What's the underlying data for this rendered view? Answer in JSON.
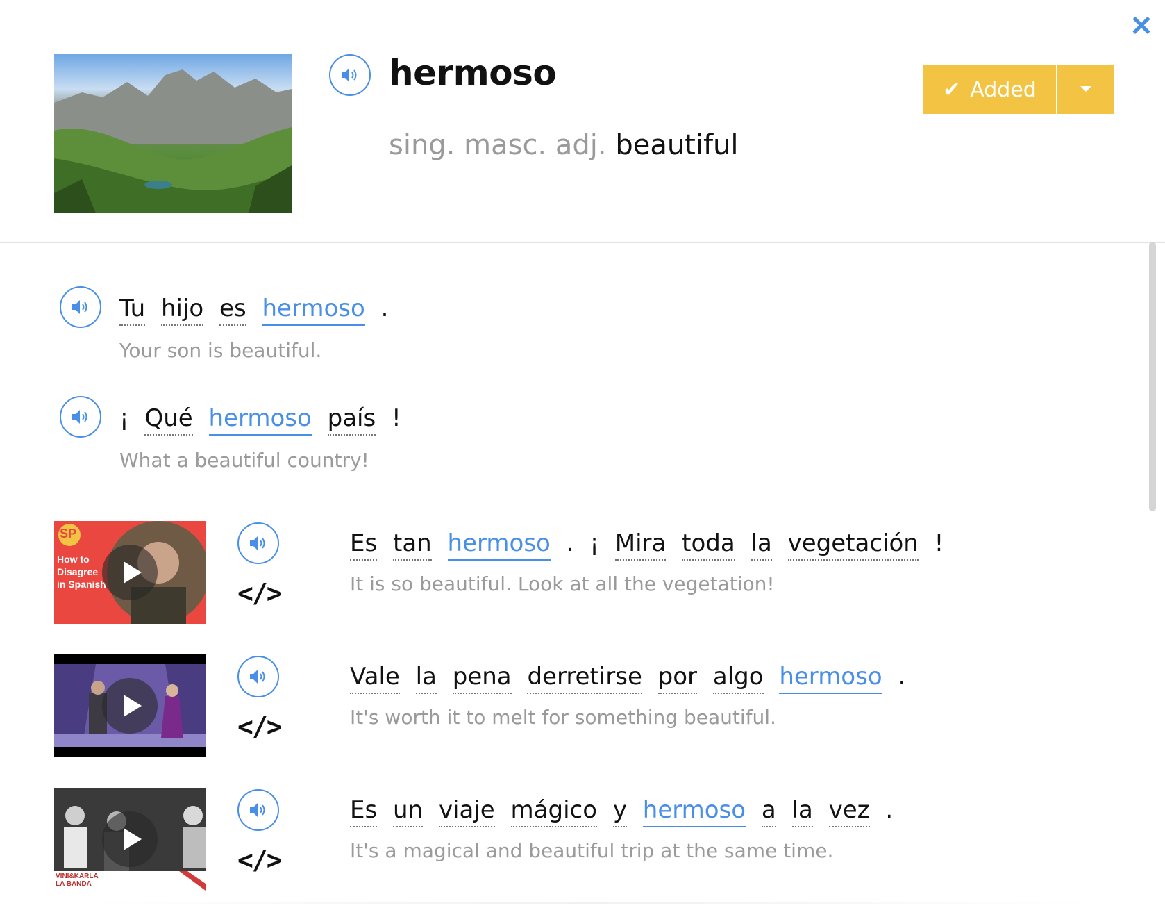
{
  "close_icon": "close-icon",
  "header": {
    "word": "hermoso",
    "pos": "sing. masc. adj.",
    "meaning": "beautiful",
    "added_label": "Added",
    "added_color": "#f3c443",
    "accent_color": "#4a8fe7"
  },
  "examples": [
    {
      "words": [
        "Tu",
        "hijo",
        "es",
        "hermoso",
        "."
      ],
      "highlight": "hermoso",
      "translation": "Your son is beautiful."
    },
    {
      "words": [
        "¡",
        "Qué",
        "hermoso",
        "país",
        "!"
      ],
      "highlight": "hermoso",
      "translation": "What a beautiful country!"
    }
  ],
  "videos": [
    {
      "thumb_text": [
        "SP",
        "How to",
        "Disagree",
        "in Spanish"
      ],
      "words": [
        "Es",
        "tan",
        "hermoso",
        ".",
        "¡",
        "Mira",
        "toda",
        "la",
        "vegetación",
        "!"
      ],
      "translation": "It is so beautiful. Look at all the vegetation!",
      "embed": "</>"
    },
    {
      "thumb_text": [],
      "words": [
        "Vale",
        "la",
        "pena",
        "derretirse",
        "por",
        "algo",
        "hermoso",
        "."
      ],
      "translation": "It's worth it to melt for something beautiful.",
      "embed": "</>"
    },
    {
      "thumb_text": [
        "VINI&KARLA",
        "LA BANDA"
      ],
      "words": [
        "Es",
        "un",
        "viaje",
        "mágico",
        "y",
        "hermoso",
        "a",
        "la",
        "vez",
        "."
      ],
      "translation": "It's a magical and beautiful trip at the same time.",
      "embed": "</>"
    }
  ]
}
